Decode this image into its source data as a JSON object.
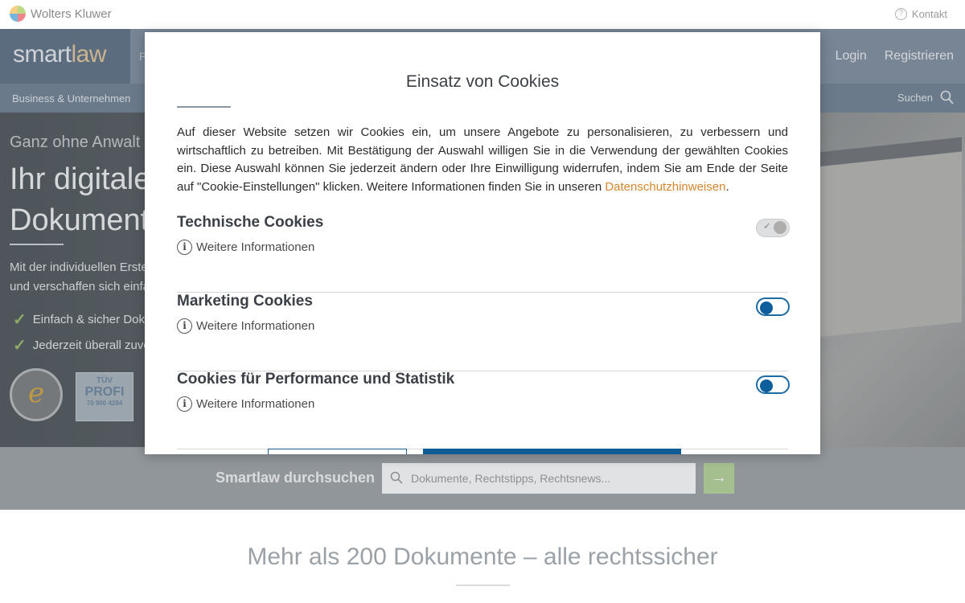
{
  "topbar": {
    "brand": "Wolters Kluwer",
    "contact": "Kontakt"
  },
  "nav": {
    "logo_a": "smart",
    "logo_b": "law",
    "fragment": "P",
    "login": "Login",
    "register": "Registrieren"
  },
  "subnav": {
    "section": "Business & Unternehmen",
    "search": "Suchen"
  },
  "hero": {
    "kicker": "Ganz ohne Anwalt",
    "title_line1": "Ihr digitaler",
    "title_line2": "Dokumente",
    "desc_line1": "Mit der individuellen Erste",
    "desc_line2": "und verschaffen sich einfac",
    "check1": "Einfach & sicher Doku",
    "check2": "Jederzeit überall zuver",
    "badge_ts_letter": "e",
    "badge_tuv_1": "TÜV",
    "badge_tuv_2": "PROFI",
    "badge_tuv_3": "70 900 4284"
  },
  "search_strip": {
    "label": "Smartlaw durchsuchen",
    "placeholder": "Dokumente, Rechtstipps, Rechtsnews..."
  },
  "below": {
    "headline": "Mehr als 200 Dokumente – alle rechtssicher"
  },
  "modal": {
    "title": "Einsatz von Cookies",
    "body": "Auf dieser Website setzen wir Cookies ein, um unsere Angebote zu personalisieren, zu verbessern und wirtschaftlich zu betreiben. Mit Bestätigung der Auswahl willigen Sie in die Verwendung der gewählten Cookies ein. Diese Auswahl können Sie jederzeit ändern oder Ihre Einwilligung widerrufen, indem Sie am Ende der Seite auf \"Cookie-Einstellungen\" klicken. Weitere Informationen finden Sie in unseren",
    "privacy_link": "Datenschutzhinweisen",
    "body_end": ".",
    "categories": [
      {
        "title": "Technische Cookies",
        "info": "Weitere Informationen",
        "state": "locked"
      },
      {
        "title": "Marketing Cookies",
        "info": "Weitere Informationen",
        "state": "off"
      },
      {
        "title": "Cookies für Performance und Statistik",
        "info": "Weitere Informationen",
        "state": "off"
      }
    ]
  },
  "colors": {
    "accent_link": "#d5862d",
    "toggle_blue": "#0d5e9c",
    "nav_bg": "#7e8ea0"
  }
}
